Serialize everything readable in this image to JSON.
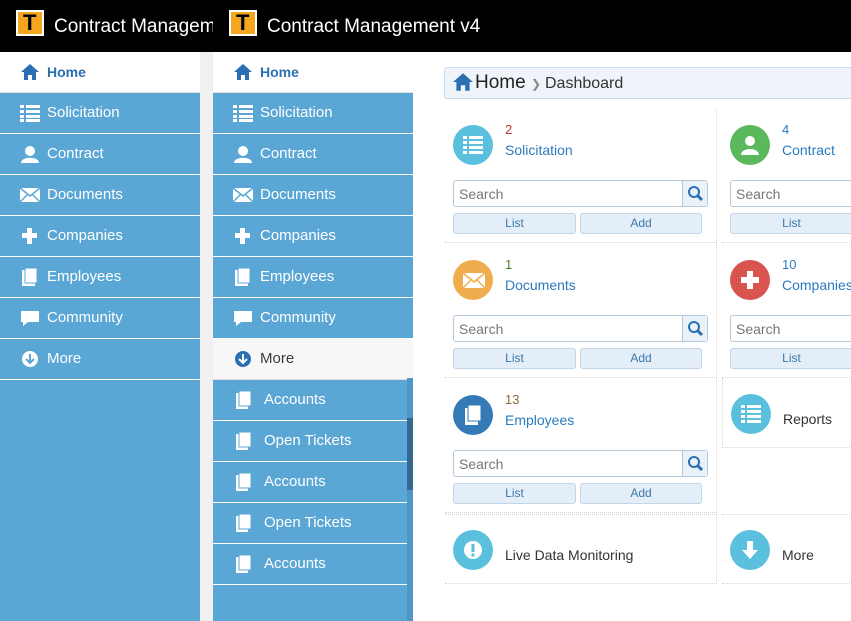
{
  "app": {
    "title": "Contract Management v4",
    "title_truncated": "Contract Manageme",
    "logo_letter": "T"
  },
  "menu": {
    "items": [
      {
        "label": "Home",
        "icon": "home-icon"
      },
      {
        "label": "Solicitation",
        "icon": "list-icon"
      },
      {
        "label": "Contract",
        "icon": "user-icon"
      },
      {
        "label": "Documents",
        "icon": "envelope-icon"
      },
      {
        "label": "Companies",
        "icon": "plus-icon"
      },
      {
        "label": "Employees",
        "icon": "book-icon"
      },
      {
        "label": "Community",
        "icon": "comment-icon"
      },
      {
        "label": "More",
        "icon": "arrow-down-circle-icon"
      }
    ],
    "submenu": [
      {
        "label": "Accounts",
        "icon": "book-icon"
      },
      {
        "label": "Open Tickets",
        "icon": "book-icon"
      },
      {
        "label": "Accounts",
        "icon": "book-icon"
      },
      {
        "label": "Open Tickets",
        "icon": "book-icon"
      },
      {
        "label": "Accounts",
        "icon": "book-icon"
      }
    ]
  },
  "breadcrumb": {
    "home": "Home",
    "current": "Dashboard"
  },
  "dashboard": {
    "search_placeholder": "Search",
    "list_label": "List",
    "add_label": "Add",
    "cards": [
      {
        "count": "2",
        "label": "Solicitation",
        "icon": "list-icon",
        "color": "#5bc0de",
        "count_color": "#c0392b"
      },
      {
        "count": "4",
        "label": "Contract",
        "icon": "user-icon",
        "color": "#5cb85c",
        "count_color": "#2a7bbf"
      },
      {
        "count": "1",
        "label": "Documents",
        "icon": "envelope-icon",
        "color": "#f0ad4e",
        "count_color": "#4d7a24"
      },
      {
        "count": "10",
        "label": "Companies",
        "icon": "plus-icon",
        "color": "#d9534f",
        "count_color": "#2a7bbf"
      },
      {
        "count": "13",
        "label": "Employees",
        "icon": "book-icon",
        "color": "#337ab7",
        "count_color": "#8a6d3b"
      },
      {
        "label": "Reports",
        "icon": "list-icon",
        "color": "#5bc0de"
      },
      {
        "label": "Live Data Monitoring",
        "icon": "alert-icon",
        "color": "#5bc0de"
      },
      {
        "label": "More",
        "icon": "arrow-down-icon",
        "color": "#5bc0de"
      }
    ]
  },
  "colors": {
    "sidebar": "#5aa7d6",
    "header": "#000000",
    "accent": "#2a6fb2"
  }
}
